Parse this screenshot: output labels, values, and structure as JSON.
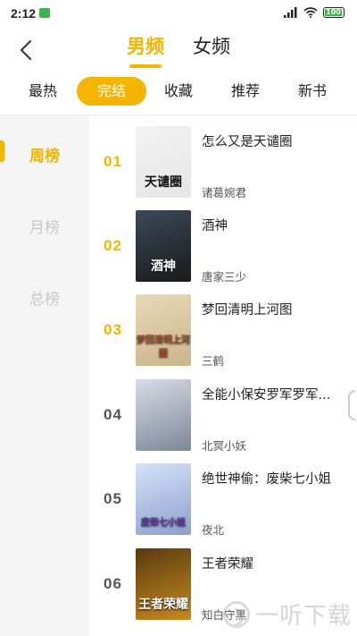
{
  "status": {
    "time": "2:12",
    "battery": "100"
  },
  "header": {
    "tabs": [
      {
        "label": "男频",
        "active": true
      },
      {
        "label": "女频",
        "active": false
      }
    ]
  },
  "categories": [
    {
      "label": "最热",
      "active": false
    },
    {
      "label": "完结",
      "active": true
    },
    {
      "label": "收藏",
      "active": false
    },
    {
      "label": "推荐",
      "active": false
    },
    {
      "label": "新书",
      "active": false
    }
  ],
  "sidebar": {
    "items": [
      {
        "label": "周榜",
        "active": true
      },
      {
        "label": "月榜",
        "active": false
      },
      {
        "label": "总榜",
        "active": false
      }
    ]
  },
  "books": [
    {
      "rank": "01",
      "title": "怎么又是天谴圈",
      "author": "诸葛婉君",
      "cover_text": "天谴圈",
      "cover_colors": [
        "#f2f2f2",
        "#e6e6e6"
      ],
      "cover_text_color": "#111"
    },
    {
      "rank": "02",
      "title": "酒神",
      "author": "唐家三少",
      "cover_text": "酒神",
      "cover_colors": [
        "#3a4a5a",
        "#1a1a1a"
      ],
      "cover_text_color": "#fff"
    },
    {
      "rank": "03",
      "title": "梦回清明上河图",
      "author": "三鹤",
      "cover_text": "梦回清明上河图",
      "cover_colors": [
        "#e9d8b8",
        "#cbb48a"
      ],
      "cover_text_color": "#a0522d"
    },
    {
      "rank": "04",
      "title": "全能小保安罗军罗军...",
      "author": "北冥小妖",
      "cover_text": "",
      "cover_colors": [
        "#d8dde6",
        "#7c8797"
      ],
      "cover_text_color": "#fff"
    },
    {
      "rank": "05",
      "title": "绝世神偷：废柴七小姐",
      "author": "夜北",
      "cover_text": "废柴七小姐",
      "cover_colors": [
        "#d7e2f7",
        "#8aa0d0"
      ],
      "cover_text_color": "#6a3aa0"
    },
    {
      "rank": "06",
      "title": "王者荣耀",
      "author": "知白守黑",
      "cover_text": "王者荣耀",
      "cover_colors": [
        "#5a3a10",
        "#c88a20"
      ],
      "cover_text_color": "#fff"
    }
  ],
  "watermark": {
    "text": "一听下载"
  },
  "colors": {
    "accent": "#f5b400"
  }
}
